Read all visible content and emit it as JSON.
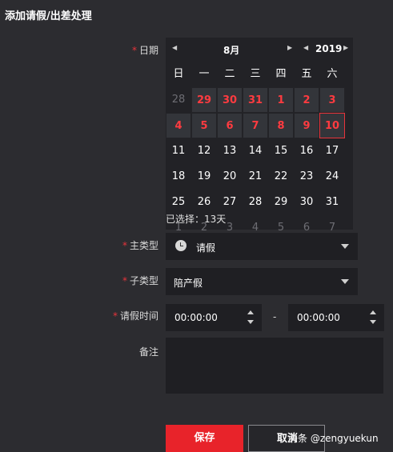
{
  "dialog": {
    "title": "添加请假/出差处理"
  },
  "labels": {
    "date": "日期",
    "main_type": "主类型",
    "sub_type": "子类型",
    "leave_time": "请假时间",
    "remark": "备注",
    "required_mark": "*"
  },
  "calendar": {
    "month": "8月",
    "year": "2019",
    "weekdays": [
      "日",
      "一",
      "二",
      "三",
      "四",
      "五",
      "六"
    ],
    "rows": [
      [
        "28",
        "29",
        "30",
        "31",
        "1",
        "2",
        "3"
      ],
      [
        "4",
        "5",
        "6",
        "7",
        "8",
        "9",
        "10"
      ],
      [
        "11",
        "12",
        "13",
        "14",
        "15",
        "16",
        "17"
      ],
      [
        "18",
        "19",
        "20",
        "21",
        "22",
        "23",
        "24"
      ],
      [
        "25",
        "26",
        "27",
        "28",
        "29",
        "30",
        "31"
      ],
      [
        "1",
        "2",
        "3",
        "4",
        "5",
        "6",
        "7"
      ]
    ],
    "selected_summary": "已选择：13天"
  },
  "fields": {
    "main_type_value": "请假",
    "sub_type_value": "陪产假",
    "start_time": "00:00:00",
    "end_time": "00:00:00",
    "time_separator": "-"
  },
  "buttons": {
    "save": "保存",
    "cancel": "取消"
  },
  "watermark": "头条 @zengyuekun",
  "colors": {
    "accent": "#e8232a",
    "selected_day": "#ff3b40"
  }
}
